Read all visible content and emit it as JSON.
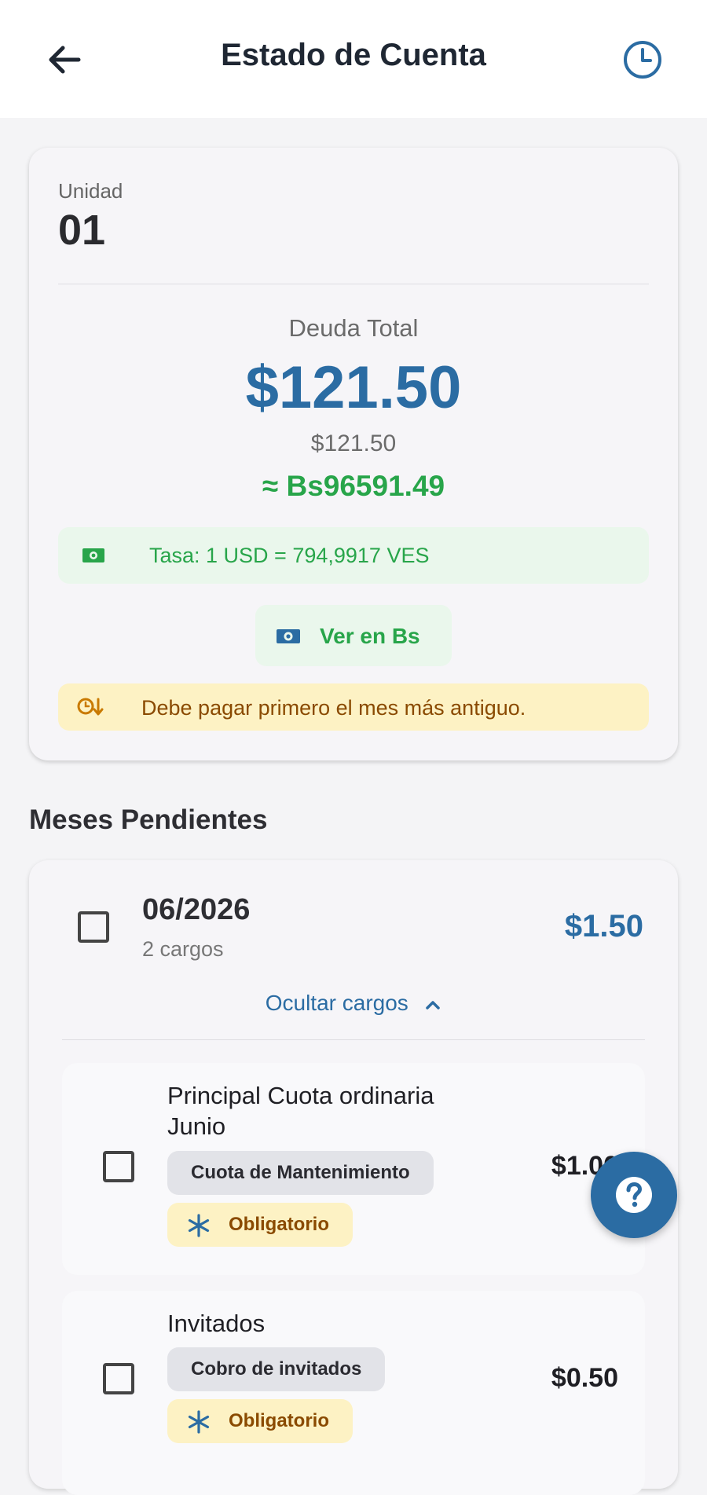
{
  "appbar": {
    "title": "Estado de Cuenta",
    "back_icon": "arrow-left-icon",
    "history_icon": "clock-icon"
  },
  "summary": {
    "unit_label": "Unidad",
    "unit_value": "01",
    "debt_label": "Deuda Total",
    "debt_amount": "$121.50",
    "debt_secondary": "$121.50",
    "debt_bs": "≈ Bs96591.49",
    "rate_text": "Tasa: 1 USD = 794,9917 VES",
    "ver_bs_label": "Ver en Bs",
    "warning_text": "Debe pagar primero el mes más antiguo."
  },
  "pending": {
    "section_title": "Meses Pendientes",
    "month": {
      "name": "06/2026",
      "count": "2 cargos",
      "total": "$1.50",
      "toggle_label": "Ocultar cargos",
      "charges": [
        {
          "title": "Principal Cuota ordinaria Junio",
          "type": "Cuota de Mantenimiento",
          "required": "Obligatorio",
          "amount": "$1.00"
        },
        {
          "title": "Invitados",
          "type": "Cobro de invitados",
          "required": "Obligatorio",
          "amount": "$0.50"
        }
      ]
    }
  },
  "colors": {
    "primary": "#2b6ca3",
    "success": "#28a54a",
    "warning_bg": "#fdf2c4",
    "warning_text": "#8a4a00"
  }
}
